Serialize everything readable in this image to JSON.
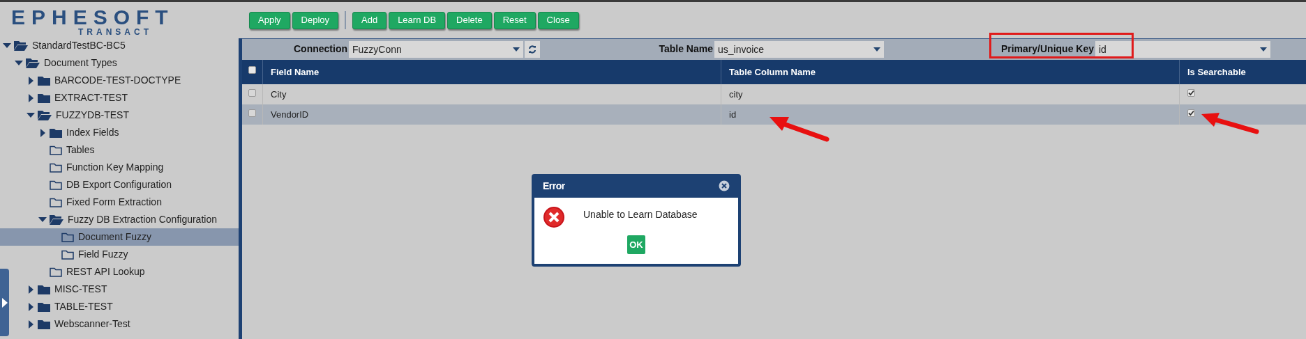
{
  "logo": {
    "wordmark": "EPHESOFT",
    "tagline": "TRANSACT"
  },
  "tree": [
    {
      "label": "StandardTestBC-BC5",
      "kind": "branch",
      "expanded": true,
      "selected": false,
      "children": [
        {
          "label": "Document Types",
          "kind": "branch",
          "expanded": true,
          "selected": false,
          "children": [
            {
              "label": "BARCODE-TEST-DOCTYPE",
              "kind": "branch",
              "expanded": false,
              "selected": false
            },
            {
              "label": "EXTRACT-TEST",
              "kind": "branch",
              "expanded": false,
              "selected": false
            },
            {
              "label": "FUZZYDB-TEST",
              "kind": "branch",
              "expanded": true,
              "selected": false,
              "children": [
                {
                  "label": "Index Fields",
                  "kind": "branch",
                  "expanded": false,
                  "selected": false
                },
                {
                  "label": "Tables",
                  "kind": "leaf",
                  "selected": false
                },
                {
                  "label": "Function Key Mapping",
                  "kind": "leaf",
                  "selected": false
                },
                {
                  "label": "DB Export Configuration",
                  "kind": "leaf",
                  "selected": false
                },
                {
                  "label": "Fixed Form Extraction",
                  "kind": "leaf",
                  "selected": false
                },
                {
                  "label": "Fuzzy DB Extraction Configuration",
                  "kind": "branch",
                  "expanded": true,
                  "selected": false,
                  "children": [
                    {
                      "label": "Document Fuzzy",
                      "kind": "leaf",
                      "selected": true
                    },
                    {
                      "label": "Field Fuzzy",
                      "kind": "leaf",
                      "selected": false
                    }
                  ]
                },
                {
                  "label": "REST API Lookup",
                  "kind": "leaf",
                  "selected": false
                }
              ]
            },
            {
              "label": "MISC-TEST",
              "kind": "branch",
              "expanded": false,
              "selected": false
            },
            {
              "label": "TABLE-TEST",
              "kind": "branch",
              "expanded": false,
              "selected": false
            },
            {
              "label": "Webscanner-Test",
              "kind": "branch",
              "expanded": false,
              "selected": false
            }
          ]
        }
      ]
    }
  ],
  "toolbar": {
    "groups": [
      [
        "Apply",
        "Deploy"
      ],
      [
        "Add",
        "Learn DB",
        "Delete",
        "Reset",
        "Close"
      ]
    ]
  },
  "filters": {
    "connection": {
      "label": "Connection",
      "value": "FuzzyConn"
    },
    "table_name": {
      "label": "Table Name",
      "value": "us_invoice"
    },
    "primary_key": {
      "label": "Primary/Unique Key",
      "value": "id",
      "highlighted": true
    }
  },
  "table": {
    "select_all": {
      "checked": false
    },
    "columns": [
      "Field Name",
      "Table Column Name",
      "Is Searchable"
    ],
    "rows": [
      {
        "field_name": "City",
        "column_name": "city",
        "checked": false,
        "searchable": true,
        "selected": false
      },
      {
        "field_name": "VendorID",
        "column_name": "id",
        "checked": false,
        "searchable": true,
        "selected": true
      }
    ]
  },
  "dialog": {
    "title": "Error",
    "message": "Unable to Learn Database",
    "button": "OK"
  }
}
